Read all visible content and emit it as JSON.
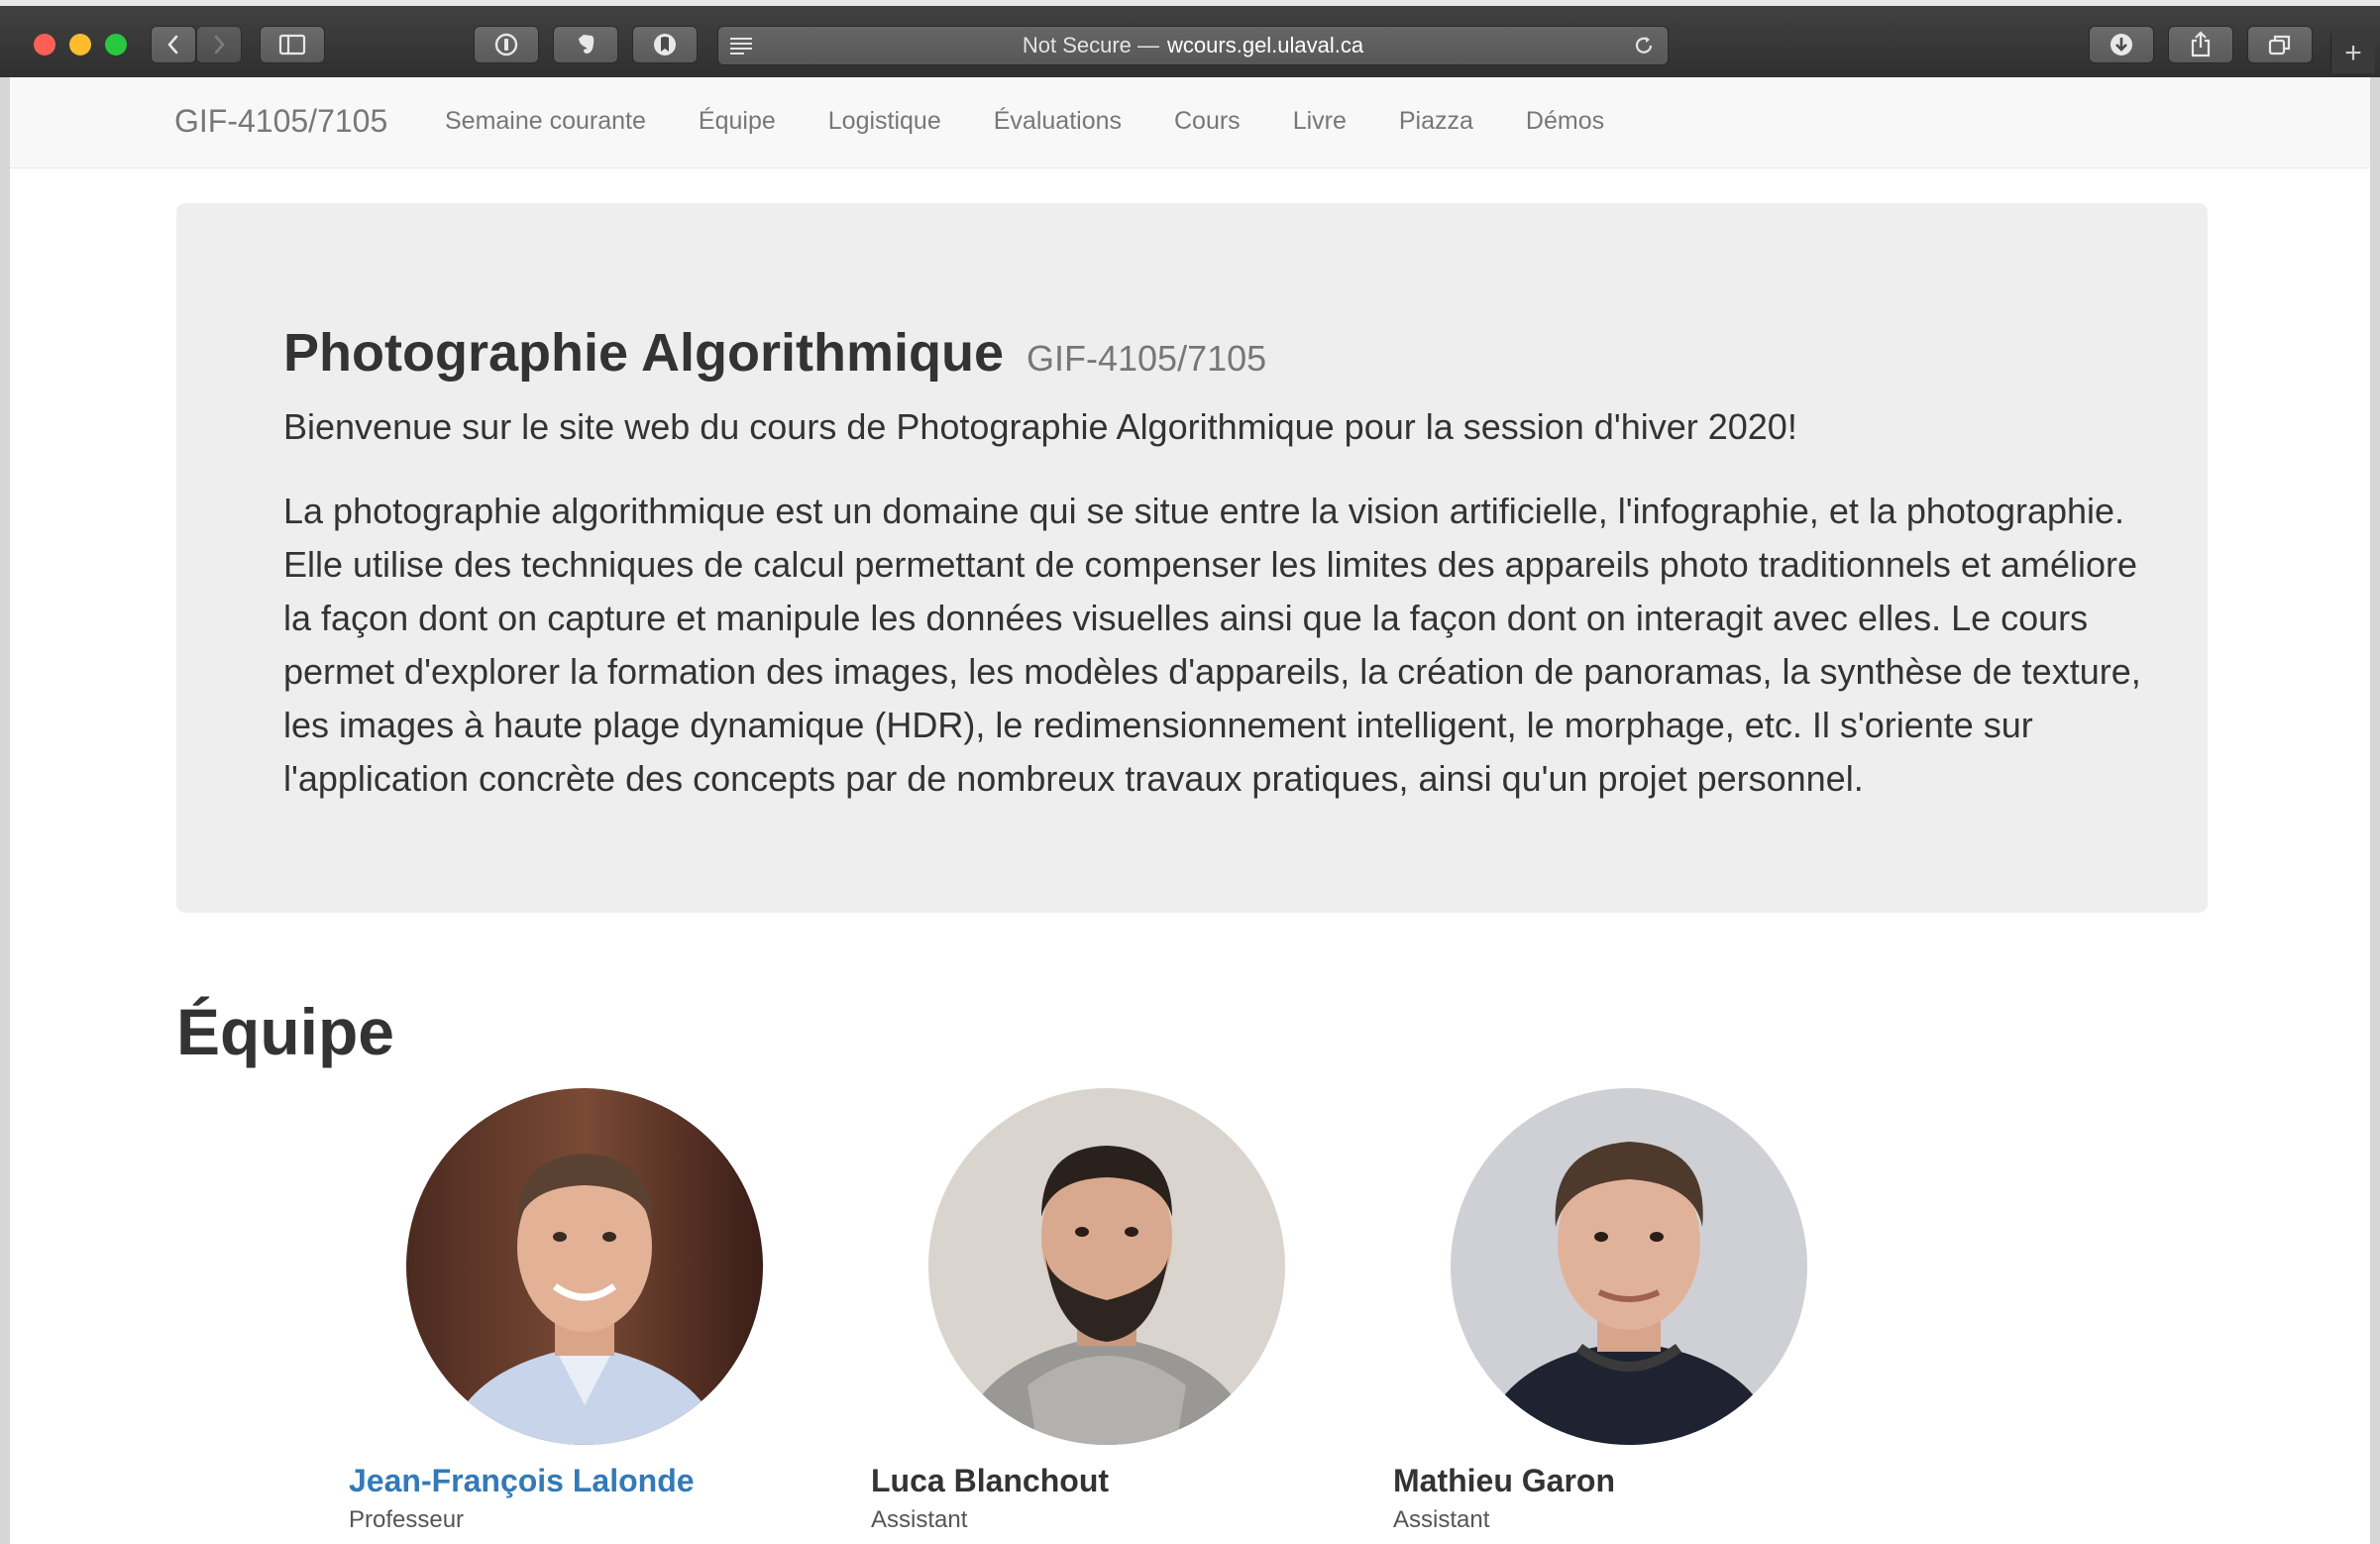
{
  "browser": {
    "url_prefix": "Not Secure —",
    "url_domain": "wcours.gel.ulaval.ca",
    "new_tab_label": "+",
    "icons": [
      "back-icon",
      "forward-icon",
      "sidebar-icon",
      "password-icon",
      "evernote-icon",
      "shield-icon",
      "reader-icon",
      "reload-icon",
      "download-icon",
      "share-icon",
      "tabs-icon"
    ]
  },
  "navbar": {
    "brand": "GIF-4105/7105",
    "links": [
      "Semaine courante",
      "Équipe",
      "Logistique",
      "Évaluations",
      "Cours",
      "Livre",
      "Piazza",
      "Démos"
    ]
  },
  "jumbotron": {
    "title": "Photographie Algorithmique",
    "code": "GIF-4105/7105",
    "welcome": "Bienvenue sur le site web du cours de Photographie Algorithmique pour la session d'hiver 2020!",
    "description": "La photographie algorithmique est un domaine qui se situe entre la vision artificielle, l'infographie, et la photographie. Elle utilise des techniques de calcul permettant de compenser les limites des appareils photo traditionnels et améliore la façon dont on capture et manipule les données visuelles ainsi que la façon dont on interagit avec elles. Le cours permet d'explorer la formation des images, les modèles d'appareils, la création de panoramas, la synthèse de texture, les images à haute plage dynamique (HDR), le redimensionnement intelligent, le morphage, etc. Il s'oriente sur l'application concrète des concepts par de nombreux travaux pratiques, ainsi qu'un projet personnel."
  },
  "team": {
    "heading": "Équipe",
    "members": [
      {
        "name": "Jean-François Lalonde",
        "role": "Professeur",
        "is_link": true
      },
      {
        "name": "Luca Blanchout",
        "role": "Assistant",
        "is_link": false
      },
      {
        "name": "Mathieu Garon",
        "role": "Assistant",
        "is_link": false
      }
    ]
  },
  "colors": {
    "link": "#337ab7",
    "jumbotron_bg": "#eeeeee",
    "navbar_bg": "#f8f8f8",
    "text": "#333333"
  }
}
